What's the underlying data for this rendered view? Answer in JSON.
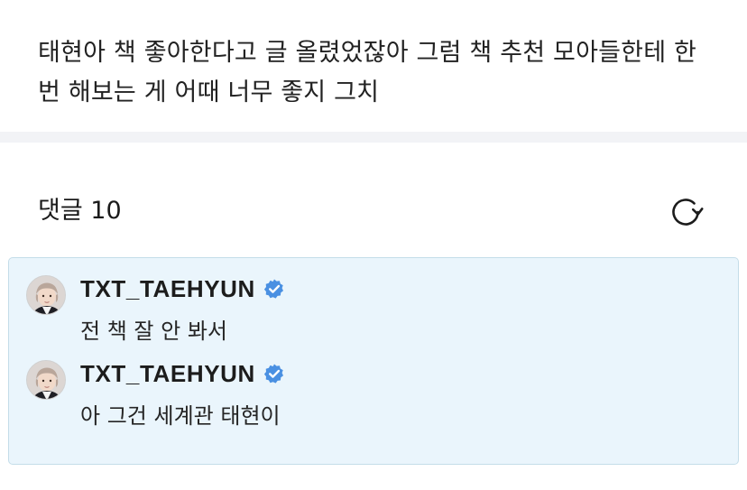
{
  "post": {
    "body": "태현아 책 좋아한다고 글 올렸었잖아 그럼 책 추천 모아들한테 한 번 해보는 게 어때 너무 좋지 그치"
  },
  "comments": {
    "count_label": "댓글 10",
    "refresh_icon": "refresh-icon"
  },
  "replies": [
    {
      "author": "TXT_TAEHYUN",
      "verified": true,
      "text": "전 책 잘 안 봐서"
    },
    {
      "author": "TXT_TAEHYUN",
      "verified": true,
      "text": "아 그건 세계관 태현이"
    }
  ],
  "colors": {
    "verified_badge": "#4a90e2",
    "reply_background": "#eaf5fc",
    "reply_border": "#c4dde9",
    "divider": "#f2f3f6"
  }
}
